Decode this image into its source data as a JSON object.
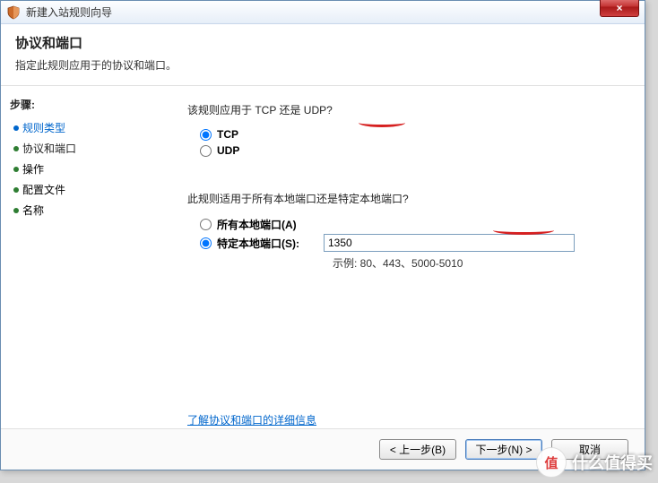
{
  "window": {
    "title": "新建入站规则向导",
    "close": "×"
  },
  "header": {
    "title": "协议和端口",
    "subtitle": "指定此规则应用于的协议和端口。"
  },
  "sidebar": {
    "heading": "步骤:",
    "items": [
      {
        "label": "规则类型",
        "state": "done"
      },
      {
        "label": "协议和端口",
        "state": "current"
      },
      {
        "label": "操作",
        "state": "pending"
      },
      {
        "label": "配置文件",
        "state": "pending"
      },
      {
        "label": "名称",
        "state": "pending"
      }
    ]
  },
  "content": {
    "protocol_question": "该规则应用于 TCP 还是 UDP?",
    "protocol_options": {
      "tcp": {
        "label": "TCP",
        "selected": true
      },
      "udp": {
        "label": "UDP",
        "selected": false
      }
    },
    "port_question": "此规则适用于所有本地端口还是特定本地端口?",
    "port_options": {
      "all": {
        "label": "所有本地端口(A)",
        "selected": false
      },
      "specific": {
        "label": "特定本地端口(S):",
        "selected": true
      }
    },
    "port_value": "1350",
    "port_example_prefix": "示例: ",
    "port_example": "80、443、5000-5010",
    "learn_link": "了解协议和端口的详细信息"
  },
  "footer": {
    "back": "< 上一步(B)",
    "next": "下一步(N) >",
    "cancel": "取消"
  },
  "watermark": {
    "logo": "值",
    "text": "什么值得买"
  }
}
